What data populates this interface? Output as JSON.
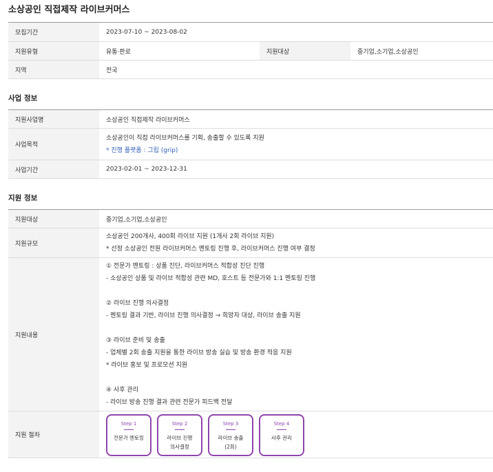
{
  "title": "소상공인 직접제작 라이브커머스",
  "summary": {
    "period_label": "모집기간",
    "period_value": "2023-07-10 ~ 2023-08-02",
    "type_label": "지원유형",
    "type_value": "유통·판로",
    "target_label": "지원대상",
    "target_value": "중기업,소기업,소상공인",
    "region_label": "지역",
    "region_value": "전국"
  },
  "business": {
    "heading": "사업 정보",
    "name_label": "지원사업명",
    "name_value": "소상공인 직접제작 라이브커머스",
    "purpose_label": "사업목적",
    "purpose_line1": "소상공인이 직접 라이브커머스를 기획, 송출할 수 있도록 지원",
    "purpose_line2": "* 진행 플랫폼 : 그립 (grip)",
    "period_label": "사업기간",
    "period_value": "2023-02-01 ~ 2023-12-31"
  },
  "support": {
    "heading": "지원 정보",
    "target_label": "지원대상",
    "target_value": "중기업,소기업,소상공인",
    "scale_label": "지원규모",
    "scale_line1": "소상공인 200개사, 400회 라이브 지원 (1개사 2회 라이브 지원)",
    "scale_line2": "* 선정 소상공인 전원 라이브커머스 멘토링 진행 후, 라이브커머스 진행 여부 결정",
    "content_label": "지원내용",
    "content_lines": [
      "① 전문가 멘토링 : 상품 진단, 라이브커머스 적합성 진단 진행",
      "- 소상공인 상품 및 라이브 적합성 관련 MD, 호스트 등 전문가와 1:1 멘토링 진행",
      "",
      "② 라이브 진행 의사결정",
      "- 멘토링 결과 기반, 라이브 진행 의사결정 → 희망자 대상, 라이브 송출 지원",
      "",
      "③ 라이브 준비 및 송출",
      "- 업체별 2회 송출 지원을 통한 라이브 방송 실습 및 방송 환경 적응 지원",
      "* 라이브 홍보 및 프로모션 지원",
      "",
      "④ 사후 관리",
      "- 라이브 방송 진행 결과 관련 전문가 피드백 전달"
    ],
    "procedure_label": "지원 절차",
    "steps": [
      {
        "label": "Step 1",
        "line1": "전문가 멘토링",
        "line2": ""
      },
      {
        "label": "Step 2",
        "line1": "라이브 진행",
        "line2": "의사결정"
      },
      {
        "label": "Step 3",
        "line1": "라이브 송출",
        "line2": "(2회)"
      },
      {
        "label": "Step 4",
        "line1": "사후 관리",
        "line2": ""
      }
    ]
  }
}
